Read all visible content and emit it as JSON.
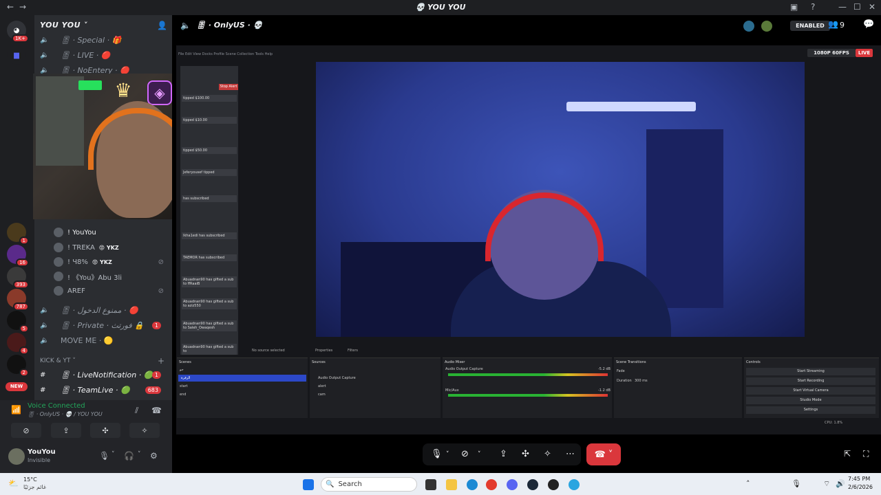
{
  "window": {
    "title": "💀 YOU YOU"
  },
  "server": {
    "name": "YOU YOU ˅"
  },
  "rail": {
    "dm_badge": "1K+",
    "servers": [
      {
        "badge": "1"
      },
      {
        "badge": "16"
      },
      {
        "badge": "393"
      },
      {
        "badge": "787"
      },
      {
        "badge": "5"
      },
      {
        "badge": "4"
      },
      {
        "badge": "2"
      }
    ],
    "new_label": "NEW"
  },
  "channels": [
    {
      "name": "🎚 · Special · 🎁",
      "badge": ""
    },
    {
      "name": "🎚 · LIVE · 🔴",
      "badge": ""
    },
    {
      "name": "🎚 · NoEntery · 🔴",
      "badge": ""
    }
  ],
  "voice_users": [
    {
      "name": "! YouYou",
      "tag": ""
    },
    {
      "name": "! TREKA",
      "tag": "😡 YKZ"
    },
    {
      "name": "! Ч8%",
      "tag": "😡 YKZ"
    },
    {
      "name": "! 《You》Abu 3li",
      "tag": ""
    },
    {
      "name": "AREF",
      "tag": ""
    }
  ],
  "channels2": [
    {
      "name": "🎚 · ممنوع الدخول · 🔴",
      "badge": ""
    },
    {
      "name": "🎚 · Private · فورتث 🔒",
      "badge": "1"
    },
    {
      "name": "MOVE ME · 🟡",
      "badge": ""
    }
  ],
  "category": "KICK & YT ˅",
  "text_channels": [
    {
      "name": "🎚 · LiveNotification · 🟢",
      "badge": "1"
    },
    {
      "name": "🎚 · TeamLive · 🟢",
      "badge": "683"
    }
  ],
  "voice": {
    "status": "Voice Connected",
    "channel": "🎚 · OnlyUS · 💀 / YOU YOU"
  },
  "user": {
    "name": "YouYou",
    "status": "Invisible"
  },
  "stage": {
    "title": "🎚 · OnlyUS · 💀",
    "enabled": "ENABLED",
    "viewers": "9",
    "quality": "1080P 60FPS",
    "live": "LIVE"
  },
  "obs": {
    "menu": "File  Edit  View  Docks  Profile  Scene Collection  Tools  Help",
    "chat_header": "Stop Alert",
    "donations": [
      {
        "text": "tipped $100.00"
      },
      {
        "text": "tipped $10.00"
      },
      {
        "text": "tipped $50.00"
      },
      {
        "text": "Jeferyousef tipped"
      },
      {
        "text": "has subscribed"
      },
      {
        "text": "Ikha1edi has subscribed"
      },
      {
        "text": "TAEMOR has subscribed"
      },
      {
        "text": "Abuadnan90 has gifted a sub to ffRaaiB"
      },
      {
        "text": "Abuadnan90 has gifted a sub to aziz550"
      },
      {
        "text": "Abuadnan90 has gifted a sub to Saleh_Owaqesh"
      },
      {
        "text": "Abuadnan90 has gifted a sub to"
      }
    ],
    "status": "No source selected",
    "tabs": [
      "Properties",
      "Filters"
    ],
    "docks": {
      "scenes": {
        "title": "Scenes",
        "items": [
          "جو",
          "الزقرة",
          "start",
          "end"
        ]
      },
      "sources": {
        "title": "Sources",
        "items": [
          "Audio Output Capture",
          "alert",
          "cam"
        ]
      },
      "mixer": {
        "title": "Audio Mixer",
        "channels": [
          "Audio Output Capture",
          "Mic/Aux"
        ],
        "db": [
          "-5.2 dB",
          "-1.2 dB"
        ]
      },
      "transitions": {
        "title": "Scene Transitions",
        "type": "Fade",
        "duration_label": "Duration",
        "duration": "300 ms"
      },
      "controls": {
        "title": "Controls",
        "buttons": [
          "Start Streaming",
          "Start Recording",
          "Start Virtual Camera",
          "Studio Mode",
          "Settings"
        ]
      }
    },
    "footer": "CPU: 1.8%"
  },
  "taskbar": {
    "temp": "15°C",
    "weather": "غائم جزئيًا",
    "search": "Search",
    "time": "7:45 PM",
    "date": "2/6/2026"
  },
  "colors": {
    "accent": "#5865f2",
    "danger": "#da373c",
    "online": "#23a55a"
  }
}
